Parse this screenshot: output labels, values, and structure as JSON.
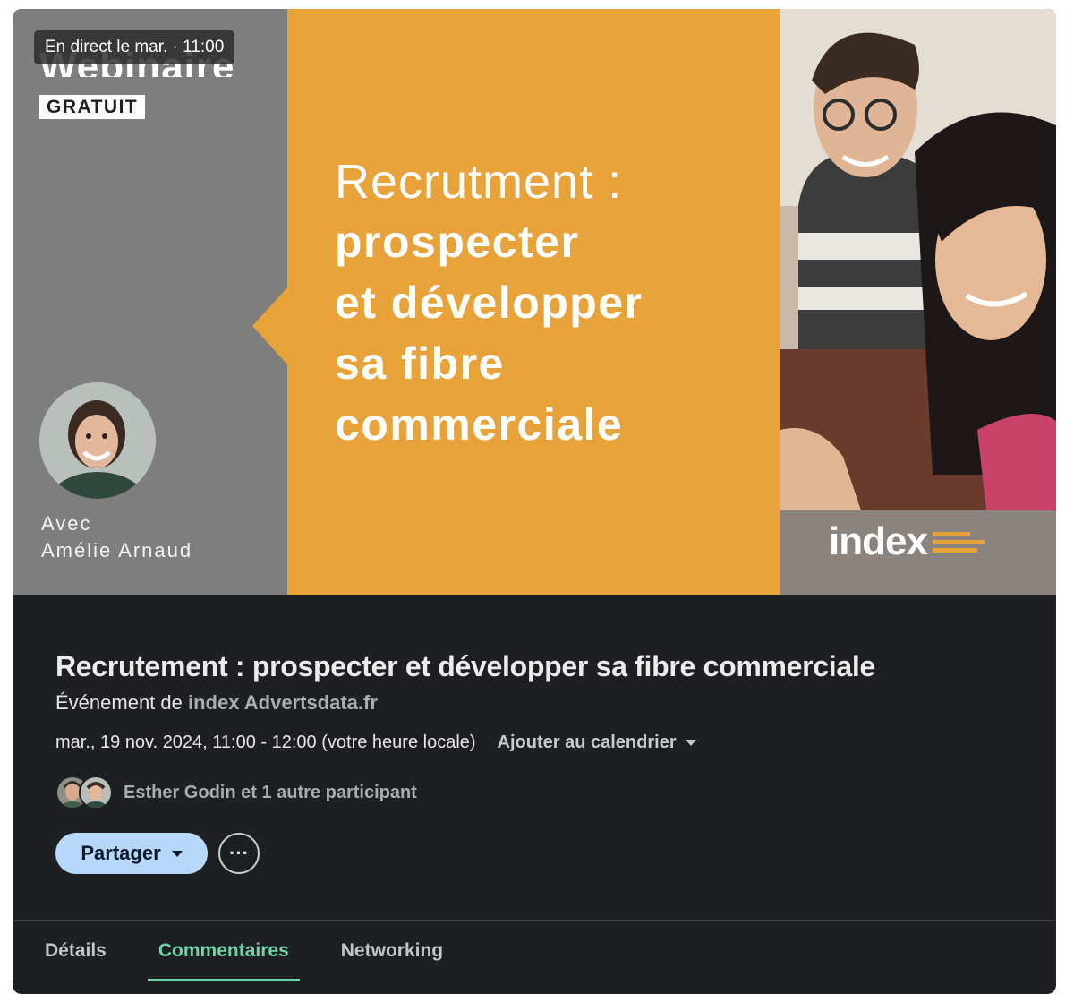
{
  "banner": {
    "live_badge": "En direct le mar. · 11:00",
    "webinaire_word": "Webinaire",
    "gratuit_label": "GRATUIT",
    "avec_label": "Avec",
    "speaker_name": "Amélie Arnaud",
    "headline_light": "Recrutment :",
    "headline_bold": [
      "prospecter",
      "et développer",
      "sa fibre",
      "commerciale"
    ],
    "brand_logo_text": "index",
    "colors": {
      "orange": "#e8a23a",
      "gray_panel": "#7e7e7e"
    }
  },
  "event": {
    "title": "Recrutement : prospecter et développer sa fibre commerciale",
    "organizer_prefix": "Événement de",
    "organizer_name": "index Advertsdata.fr",
    "datetime": "mar., 19 nov. 2024, 11:00 - 12:00 (votre heure locale)",
    "add_to_calendar": "Ajouter au calendrier",
    "attendees_text": "Esther Godin et 1 autre participant",
    "share_label": "Partager",
    "more_label": "···"
  },
  "tabs": [
    {
      "label": "Détails",
      "active": false
    },
    {
      "label": "Commentaires",
      "active": true
    },
    {
      "label": "Networking",
      "active": false
    }
  ],
  "colors": {
    "accent_green": "#6fd3a7",
    "share_blue": "#b8d8fb",
    "card_bg": "#1d1f23"
  }
}
